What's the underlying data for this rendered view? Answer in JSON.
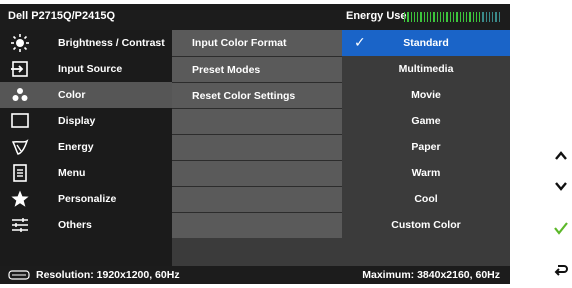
{
  "header": {
    "title": "Dell P2715Q/P2415Q",
    "energy_use_label": "Energy Use",
    "energy_level": 0.8
  },
  "left_menu": {
    "items": [
      {
        "label": "Brightness / Contrast",
        "icon": "brightness-icon"
      },
      {
        "label": "Input Source",
        "icon": "input-source-icon"
      },
      {
        "label": "Color",
        "icon": "color-icon"
      },
      {
        "label": "Display",
        "icon": "display-icon"
      },
      {
        "label": "Energy",
        "icon": "energy-icon"
      },
      {
        "label": "Menu",
        "icon": "menu-icon"
      },
      {
        "label": "Personalize",
        "icon": "star-icon"
      },
      {
        "label": "Others",
        "icon": "sliders-icon"
      }
    ],
    "active_index": 2
  },
  "submenu": {
    "items": [
      {
        "label": "Input Color Format"
      },
      {
        "label": "Preset Modes"
      },
      {
        "label": "Reset Color Settings"
      },
      {
        "label": ""
      },
      {
        "label": ""
      },
      {
        "label": ""
      },
      {
        "label": ""
      },
      {
        "label": ""
      }
    ]
  },
  "options": {
    "items": [
      {
        "label": "Standard"
      },
      {
        "label": "Multimedia"
      },
      {
        "label": "Movie"
      },
      {
        "label": "Game"
      },
      {
        "label": "Paper"
      },
      {
        "label": "Warm"
      },
      {
        "label": "Cool"
      },
      {
        "label": "Custom Color"
      }
    ],
    "selected_index": 0,
    "check_symbol": "✓"
  },
  "status": {
    "current_resolution": "Resolution: 1920x1200, 60Hz",
    "max_resolution": "Maximum: 3840x2160, 60Hz"
  },
  "side_buttons": {
    "up": "up-arrow-icon",
    "down": "down-arrow-icon",
    "ok": "check-icon",
    "back": "back-icon"
  },
  "colors": {
    "selection_blue": "#1a64c8",
    "energy_green": "#3cc43c",
    "energy_dim": "#3a8a8a"
  }
}
